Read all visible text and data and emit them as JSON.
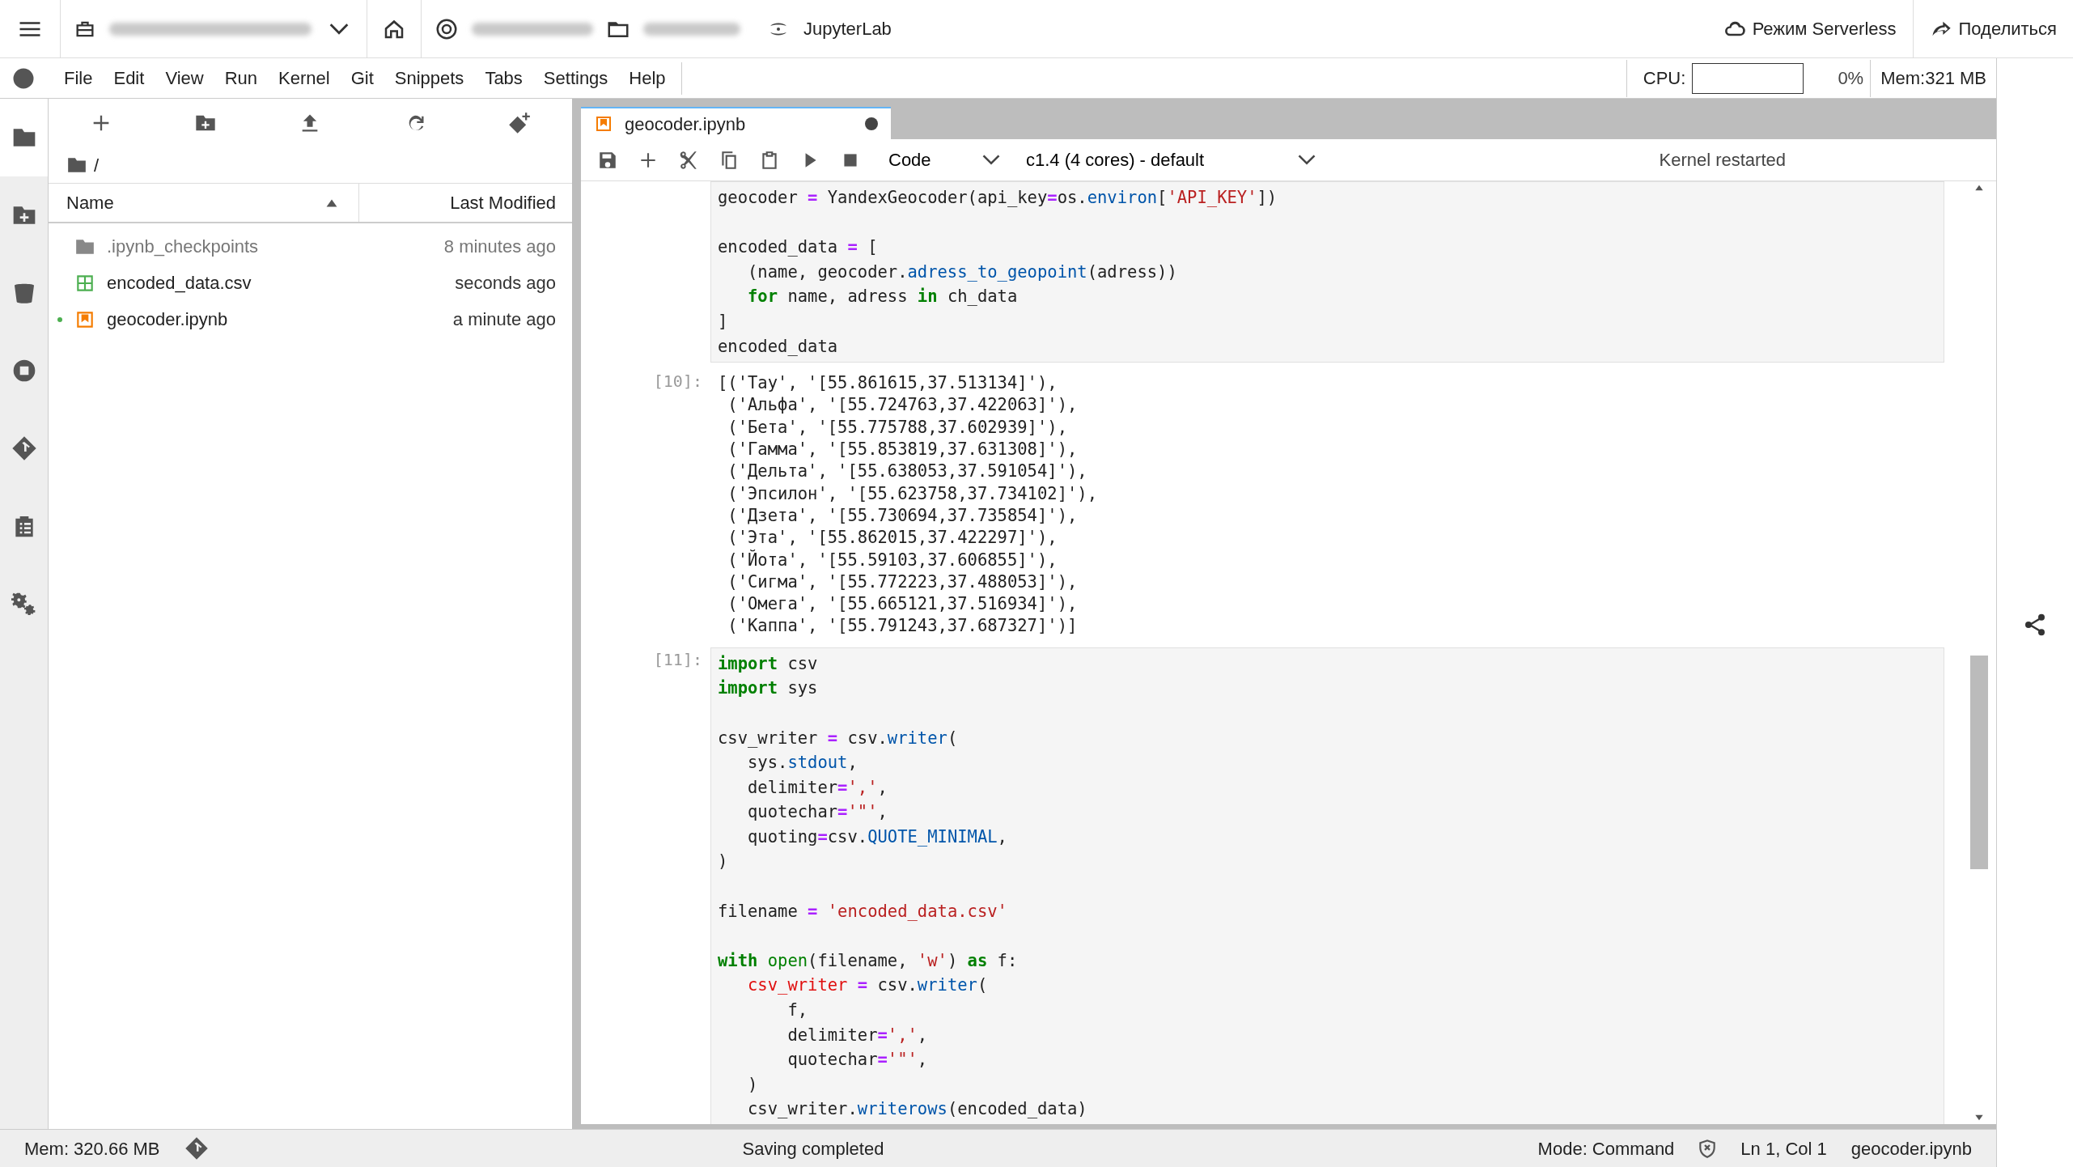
{
  "top_bar": {
    "app_name": "JupyterLab",
    "serverless_button": "Режим Serverless",
    "share_button": "Поделиться"
  },
  "menu": [
    "File",
    "Edit",
    "View",
    "Run",
    "Kernel",
    "Git",
    "Snippets",
    "Tabs",
    "Settings",
    "Help"
  ],
  "resource_usage": {
    "cpu": {
      "label": "CPU:",
      "level": 0,
      "reading": "0%"
    },
    "memory": "Mem:321 MB"
  },
  "file_browser": {
    "path": "/",
    "columns": [
      {
        "label": "Name",
        "sorted": true
      },
      {
        "label": "Last Modified",
        "sorted": false
      }
    ],
    "files": [
      {
        "kind": "folder",
        "name": ".ipynb_checkpoints",
        "modified": "8 minutes ago",
        "hidden": true,
        "running": false
      },
      {
        "kind": "csv",
        "name": "encoded_data.csv",
        "modified": "seconds ago",
        "hidden": false,
        "running": false
      },
      {
        "kind": "notebook",
        "name": "geocoder.ipynb",
        "modified": "a minute ago",
        "hidden": false,
        "running": true
      }
    ]
  },
  "notebook": {
    "tabs": [
      {
        "label": "geocoder.ipynb",
        "selected": true,
        "unsaved": true
      }
    ],
    "cell_type": "Code",
    "kernel": "c1.4 (4 cores) - default",
    "kernel_status": "Kernel restarted",
    "cells": [
      {
        "kind": "code",
        "lines": [
          {
            "kind": "code",
            "tokens": [
              {
                "kind": "p",
                "text": "geocoder "
              },
              {
                "kind": "op",
                "text": "="
              },
              {
                "kind": "p",
                "text": " YandexGeocoder(api_key"
              },
              {
                "kind": "op",
                "text": "="
              },
              {
                "kind": "p",
                "text": "os."
              },
              {
                "kind": "fn",
                "text": "environ"
              },
              {
                "kind": "p",
                "text": "["
              },
              {
                "kind": "str",
                "text": "'API_KEY'"
              },
              {
                "kind": "p",
                "text": "])"
              }
            ]
          },
          {
            "kind": "blank"
          },
          {
            "kind": "code",
            "tokens": [
              {
                "kind": "p",
                "text": "encoded_data "
              },
              {
                "kind": "op",
                "text": "="
              },
              {
                "kind": "p",
                "text": " ["
              }
            ]
          },
          {
            "kind": "code",
            "tokens": [
              {
                "kind": "p",
                "text": "   (name, geocoder."
              },
              {
                "kind": "fn",
                "text": "adress_to_geopoint"
              },
              {
                "kind": "p",
                "text": "(adress))"
              }
            ]
          },
          {
            "kind": "code",
            "tokens": [
              {
                "kind": "kw",
                "text": "   for"
              },
              {
                "kind": "p",
                "text": " name, adress "
              },
              {
                "kind": "kw",
                "text": "in"
              },
              {
                "kind": "p",
                "text": " ch_data"
              }
            ]
          },
          {
            "kind": "code",
            "tokens": [
              {
                "kind": "p",
                "text": "]"
              }
            ]
          },
          {
            "kind": "code",
            "tokens": [
              {
                "kind": "p",
                "text": "encoded_data"
              }
            ]
          }
        ]
      },
      {
        "kind": "output",
        "prompt": "[10]:",
        "lines": [
          "[('Тау', '[55.861615,37.513134]'),",
          " ('Альфа', '[55.724763,37.422063]'),",
          " ('Бета', '[55.775788,37.602939]'),",
          " ('Гамма', '[55.853819,37.631308]'),",
          " ('Дельта', '[55.638053,37.591054]'),",
          " ('Эпсилон', '[55.623758,37.734102]'),",
          " ('Дзета', '[55.730694,37.735854]'),",
          " ('Эта', '[55.862015,37.422297]'),",
          " ('Йота', '[55.59103,37.606855]'),",
          " ('Сигма', '[55.772223,37.488053]'),",
          " ('Омега', '[55.665121,37.516934]'),",
          " ('Каппа', '[55.791243,37.687327]')]"
        ]
      },
      {
        "kind": "code",
        "prompt": "[11]:",
        "lines": [
          {
            "kind": "code",
            "tokens": [
              {
                "kind": "kw",
                "text": "import"
              },
              {
                "kind": "p",
                "text": " csv"
              }
            ]
          },
          {
            "kind": "code",
            "tokens": [
              {
                "kind": "kw",
                "text": "import"
              },
              {
                "kind": "p",
                "text": " sys"
              }
            ]
          },
          {
            "kind": "blank"
          },
          {
            "kind": "code",
            "tokens": [
              {
                "kind": "p",
                "text": "csv_writer "
              },
              {
                "kind": "op",
                "text": "="
              },
              {
                "kind": "p",
                "text": " csv."
              },
              {
                "kind": "fn",
                "text": "writer"
              },
              {
                "kind": "p",
                "text": "("
              }
            ]
          },
          {
            "kind": "code",
            "tokens": [
              {
                "kind": "p",
                "text": "   sys."
              },
              {
                "kind": "fn",
                "text": "stdout"
              },
              {
                "kind": "p",
                "text": ","
              }
            ]
          },
          {
            "kind": "code",
            "tokens": [
              {
                "kind": "p",
                "text": "   delimiter"
              },
              {
                "kind": "op",
                "text": "="
              },
              {
                "kind": "str",
                "text": "','"
              },
              {
                "kind": "p",
                "text": ","
              }
            ]
          },
          {
            "kind": "code",
            "tokens": [
              {
                "kind": "p",
                "text": "   quotechar"
              },
              {
                "kind": "op",
                "text": "="
              },
              {
                "kind": "str",
                "text": "'\"'"
              },
              {
                "kind": "p",
                "text": ","
              }
            ]
          },
          {
            "kind": "code",
            "tokens": [
              {
                "kind": "p",
                "text": "   quoting"
              },
              {
                "kind": "op",
                "text": "="
              },
              {
                "kind": "p",
                "text": "csv."
              },
              {
                "kind": "fn",
                "text": "QUOTE_MINIMAL"
              },
              {
                "kind": "p",
                "text": ","
              }
            ]
          },
          {
            "kind": "code",
            "tokens": [
              {
                "kind": "p",
                "text": ")"
              }
            ]
          },
          {
            "kind": "blank"
          },
          {
            "kind": "code",
            "tokens": [
              {
                "kind": "p",
                "text": "filename "
              },
              {
                "kind": "op",
                "text": "= "
              },
              {
                "kind": "str",
                "text": "'encoded_data.csv'"
              }
            ]
          },
          {
            "kind": "blank"
          },
          {
            "kind": "code",
            "tokens": [
              {
                "kind": "kw",
                "text": "with "
              },
              {
                "kind": "bi",
                "text": "open"
              },
              {
                "kind": "p",
                "text": "(filename, "
              },
              {
                "kind": "str",
                "text": "'w'"
              },
              {
                "kind": "p",
                "text": ") "
              },
              {
                "kind": "kw",
                "text": "as"
              },
              {
                "kind": "p",
                "text": " f:"
              }
            ]
          },
          {
            "kind": "code",
            "tokens": [
              {
                "kind": "var",
                "text": "   csv_writer"
              },
              {
                "kind": "op",
                "text": " ="
              },
              {
                "kind": "p",
                "text": " csv."
              },
              {
                "kind": "fn",
                "text": "writer"
              },
              {
                "kind": "p",
                "text": "("
              }
            ]
          },
          {
            "kind": "code",
            "tokens": [
              {
                "kind": "p",
                "text": "       f,"
              }
            ]
          },
          {
            "kind": "code",
            "tokens": [
              {
                "kind": "p",
                "text": "       delimiter"
              },
              {
                "kind": "op",
                "text": "="
              },
              {
                "kind": "str",
                "text": "','"
              },
              {
                "kind": "p",
                "text": ","
              }
            ]
          },
          {
            "kind": "code",
            "tokens": [
              {
                "kind": "p",
                "text": "       quotechar"
              },
              {
                "kind": "op",
                "text": "="
              },
              {
                "kind": "str",
                "text": "'\"'"
              },
              {
                "kind": "p",
                "text": ","
              }
            ]
          },
          {
            "kind": "code",
            "tokens": [
              {
                "kind": "p",
                "text": "   )"
              }
            ]
          },
          {
            "kind": "code",
            "tokens": [
              {
                "kind": "p",
                "text": "   csv_writer."
              },
              {
                "kind": "fn",
                "text": "writerows"
              },
              {
                "kind": "p",
                "text": "(encoded_data)"
              }
            ]
          }
        ]
      }
    ]
  },
  "status_bar": {
    "memory": "Mem: 320.66 MB",
    "message": "Saving completed",
    "mode": "Mode: Command",
    "position": "Ln 1, Col 1",
    "file": "geocoder.ipynb"
  }
}
